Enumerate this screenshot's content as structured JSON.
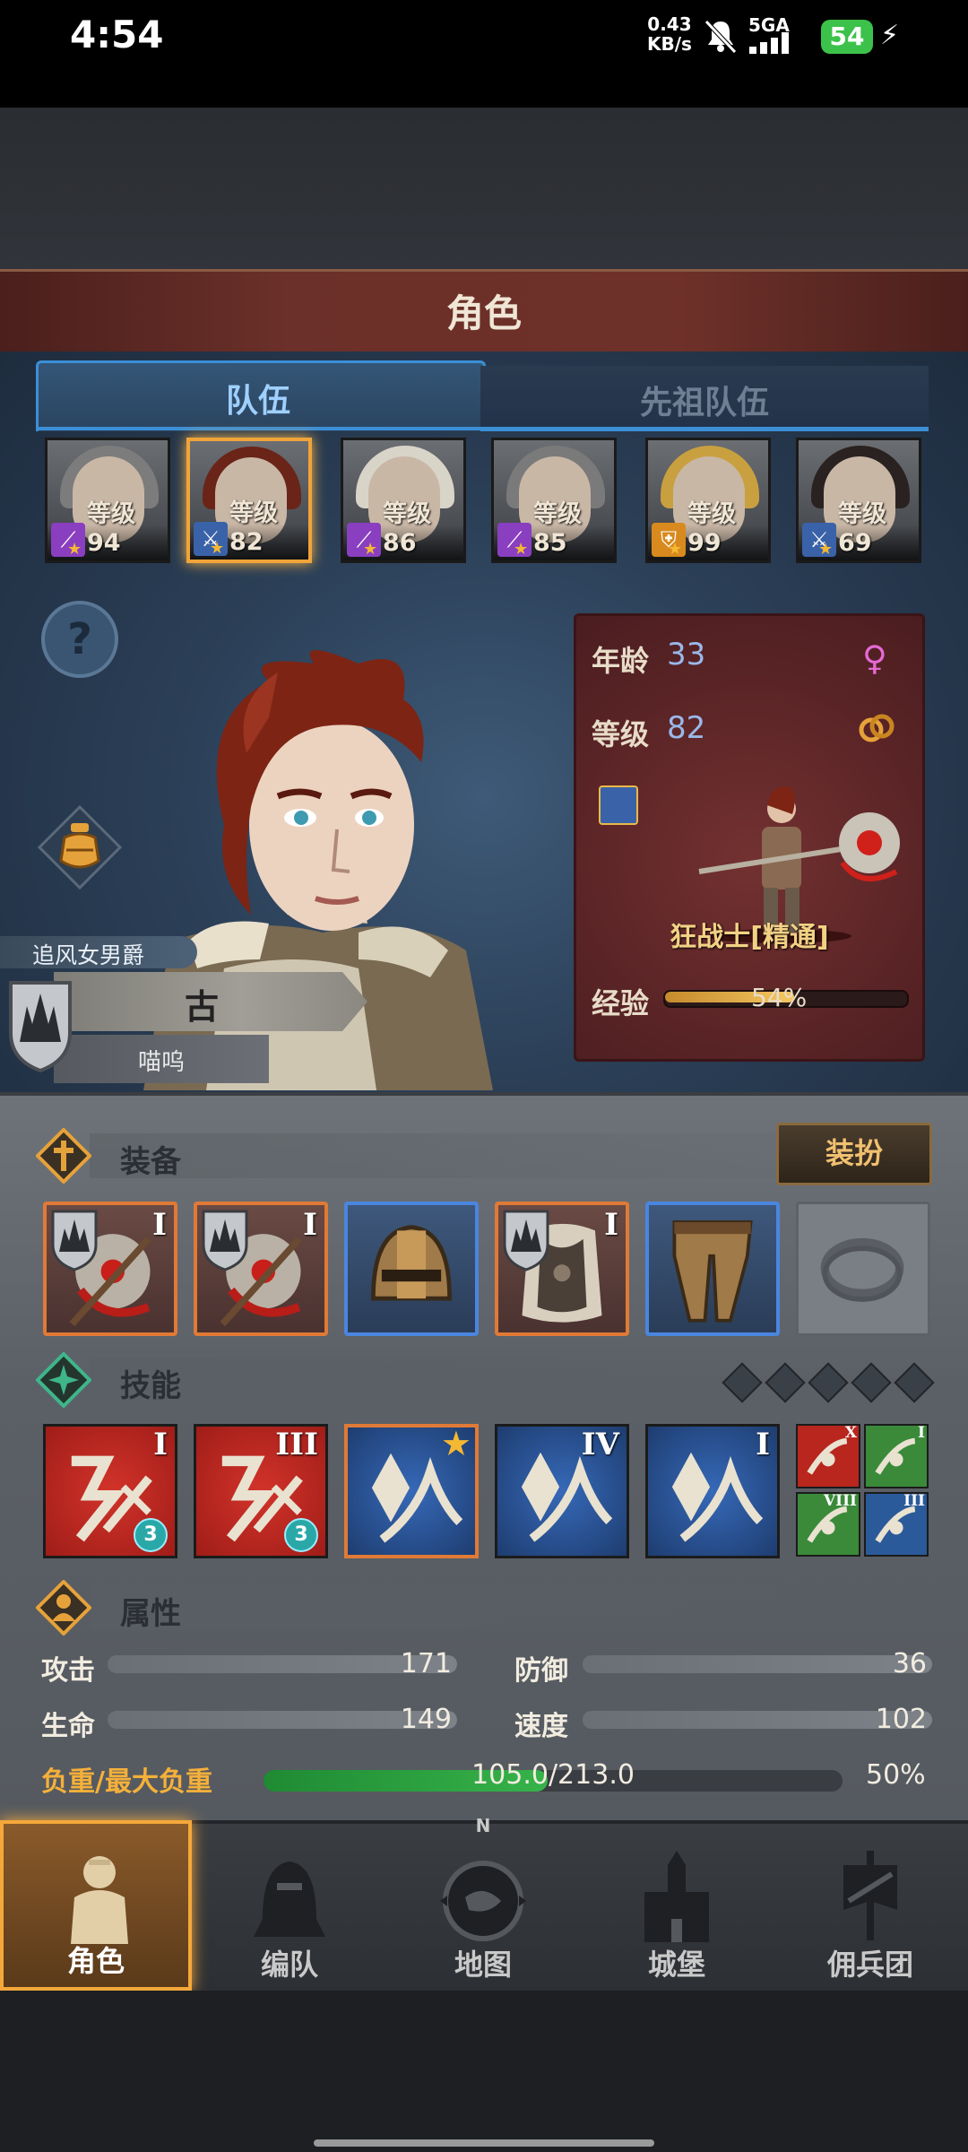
{
  "status_bar": {
    "time": "4:54",
    "net_speed_value": "0.43",
    "net_speed_unit": "KB/s",
    "signal_label": "5GA",
    "battery": "54"
  },
  "screen_title": "角色",
  "tabs": [
    {
      "label": "队伍",
      "active": true
    },
    {
      "label": "先祖队伍",
      "active": false
    }
  ],
  "party": [
    {
      "level": "等级94",
      "class_icon": "staff-icon",
      "class_color": "#8a3fc0",
      "hair": "#7c7c7c",
      "selected": false
    },
    {
      "level": "等级82",
      "class_icon": "sword-icon",
      "class_color": "#3a62a8",
      "hair": "#6a2418",
      "selected": true
    },
    {
      "level": "等级86",
      "class_icon": "staff-icon",
      "class_color": "#8a3fc0",
      "hair": "#d8d4c8",
      "selected": false
    },
    {
      "level": "等级85",
      "class_icon": "staff-icon",
      "class_color": "#8a3fc0",
      "hair": "#7a7a7a",
      "selected": false
    },
    {
      "level": "等级99",
      "class_icon": "shield-icon",
      "class_color": "#d88a1e",
      "hair": "#c9a040",
      "selected": false
    },
    {
      "level": "等级69",
      "class_icon": "sword-icon",
      "class_color": "#3a62a8",
      "hair": "#2a2220",
      "selected": false
    }
  ],
  "hero": {
    "title_badge": "追风女男爵",
    "name": "古",
    "subname": "喵呜"
  },
  "info_card": {
    "age_label": "年龄",
    "age_value": "33",
    "level_label": "等级",
    "level_value": "82",
    "class_name": "狂战士[精通]",
    "exp_label": "经验",
    "exp_percent_text": "54%",
    "exp_fraction": 0.54
  },
  "equipment": {
    "title": "装备",
    "dress_button": "装扮",
    "slots": [
      {
        "type": "axe-icon",
        "frame": "orange",
        "roman": "I",
        "guild_shield": true
      },
      {
        "type": "axe-icon",
        "frame": "orange",
        "roman": "I",
        "guild_shield": true
      },
      {
        "type": "helmet-icon",
        "frame": "blue",
        "roman": "",
        "guild_shield": false
      },
      {
        "type": "chest-armor-icon",
        "frame": "orange",
        "roman": "I",
        "guild_shield": true
      },
      {
        "type": "leg-armor-icon",
        "frame": "blue",
        "roman": "",
        "guild_shield": false
      },
      {
        "type": "ring-icon",
        "frame": "empty",
        "roman": "",
        "guild_shield": false
      }
    ]
  },
  "skills": {
    "title": "技能",
    "points_total": 5,
    "items": [
      {
        "icon": "cleave-skill-icon",
        "color": "red",
        "roman": "I",
        "count": "3",
        "selected": false
      },
      {
        "icon": "whirlwind-skill-icon",
        "color": "red",
        "roman": "III",
        "count": "3",
        "selected": false
      },
      {
        "icon": "claw-skill-icon",
        "color": "blue",
        "roman": "",
        "count": "",
        "selected": true
      },
      {
        "icon": "crystal-sword-skill-icon",
        "color": "blue",
        "roman": "IV",
        "count": "",
        "selected": false
      },
      {
        "icon": "crystal-dash-skill-icon",
        "color": "blue",
        "roman": "I",
        "count": "",
        "selected": false
      }
    ],
    "passives": [
      {
        "icon": "sword-passive-icon",
        "color": "#b8261e",
        "roman": "X"
      },
      {
        "icon": "burst-passive-icon",
        "color": "#3a8a3a",
        "roman": "I"
      },
      {
        "icon": "wind-passive-icon",
        "color": "#3a8a3a",
        "roman": "VIII"
      },
      {
        "icon": "bird-passive-icon",
        "color": "#2a5a9a",
        "roman": "III"
      }
    ]
  },
  "attributes": {
    "title": "属性",
    "attack_label": "攻击",
    "attack_value": "171",
    "defense_label": "防御",
    "defense_value": "36",
    "hp_label": "生命",
    "hp_value": "149",
    "speed_label": "速度",
    "speed_value": "102",
    "load_label": "负重/最大负重",
    "load_text": "105.0/213.0",
    "load_percent": "50%",
    "load_fraction": 0.49
  },
  "nav": [
    {
      "label": "角色",
      "icon": "knight-icon",
      "active": true
    },
    {
      "label": "编队",
      "icon": "formation-helmet-icon",
      "active": false
    },
    {
      "label": "地图",
      "icon": "compass-map-icon",
      "active": false,
      "compass_letter": "N"
    },
    {
      "label": "城堡",
      "icon": "castle-icon",
      "active": false
    },
    {
      "label": "佣兵团",
      "icon": "mercenary-banner-icon",
      "active": false
    }
  ]
}
